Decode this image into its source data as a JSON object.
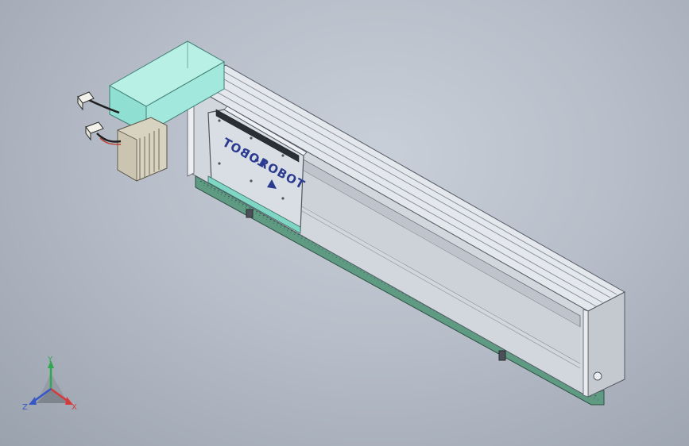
{
  "model": {
    "carriage_logo_text": "LOBOT",
    "carriage_logo_suffix": "-ROBOT"
  },
  "triad": {
    "x_label": "X",
    "y_label": "Y",
    "z_label": "Z"
  },
  "colors": {
    "background_light": "#c9cfd8",
    "background_dark": "#9aa2ae",
    "housing_teal": "#9fe3d8",
    "rail_grey": "#d3d7de",
    "carriage_plate": "#d6dae2",
    "rack_green": "#4f8a73",
    "logo_blue": "#2a3b8f",
    "axis_x": "#d63b3b",
    "axis_y": "#2fa84f",
    "axis_z": "#3757c9"
  }
}
